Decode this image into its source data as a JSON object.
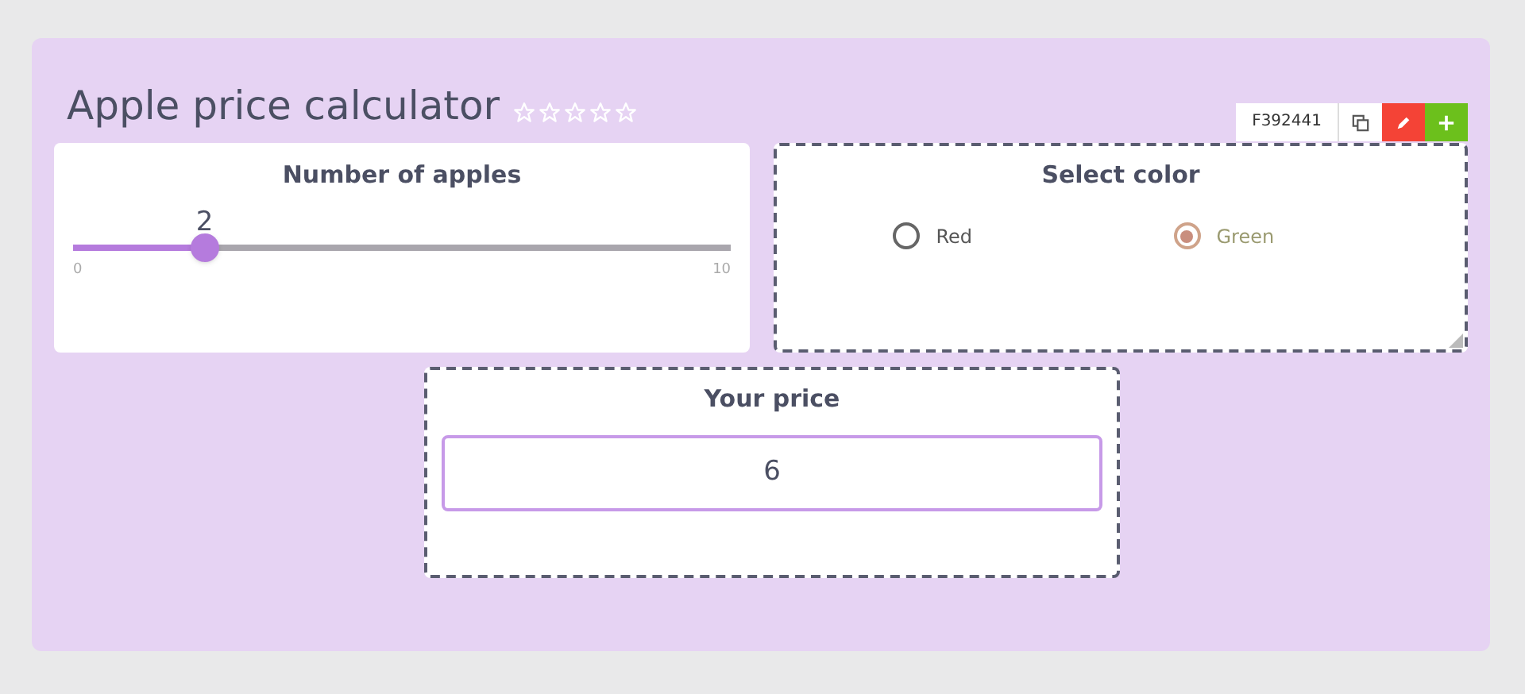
{
  "title": "Apple price calculator",
  "rating": {
    "stars": 0
  },
  "slider_panel": {
    "title": "Number of apples",
    "value": "2",
    "level": 0.2,
    "min": "0",
    "max": "10"
  },
  "color_panel": {
    "title": "Select color",
    "toolbar": {
      "id": "F392441"
    },
    "options": [
      {
        "label": "Red",
        "selected": false
      },
      {
        "label": "Green",
        "selected": true
      }
    ]
  },
  "price_panel": {
    "title": "Your price",
    "value": "6"
  }
}
